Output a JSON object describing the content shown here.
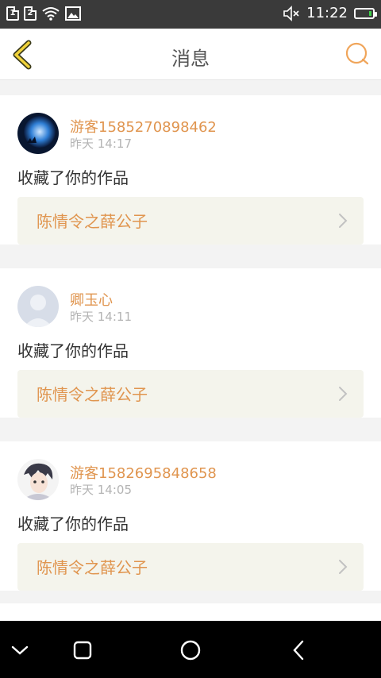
{
  "status_bar": {
    "sim1": "1",
    "sim2": "2",
    "time": "11:22",
    "icons": [
      "sim-1-icon",
      "sim-2-icon",
      "wifi-icon",
      "image-notification-icon",
      "mute-icon",
      "battery-icon"
    ]
  },
  "header": {
    "title": "消息",
    "back_icon": "chevron-left-icon",
    "search_icon": "search-icon",
    "accent_color": "#e0954f"
  },
  "messages": [
    {
      "user": "游客1585270898462",
      "time": "昨天 14:17",
      "text": "收藏了你的作品",
      "work": "陈情令之薛公子",
      "avatar": "avatar-moon-icon"
    },
    {
      "user": "卿玉心",
      "time": "昨天 14:11",
      "text": "收藏了你的作品",
      "work": "陈情令之薛公子",
      "avatar": "avatar-default-icon"
    },
    {
      "user": "游客1582695848658",
      "time": "昨天 14:05",
      "text": "收藏了你的作品",
      "work": "陈情令之薛公子",
      "avatar": "avatar-anime-icon"
    }
  ],
  "nav_keys": [
    "down-icon",
    "recent-apps-icon",
    "home-icon",
    "back-icon"
  ]
}
